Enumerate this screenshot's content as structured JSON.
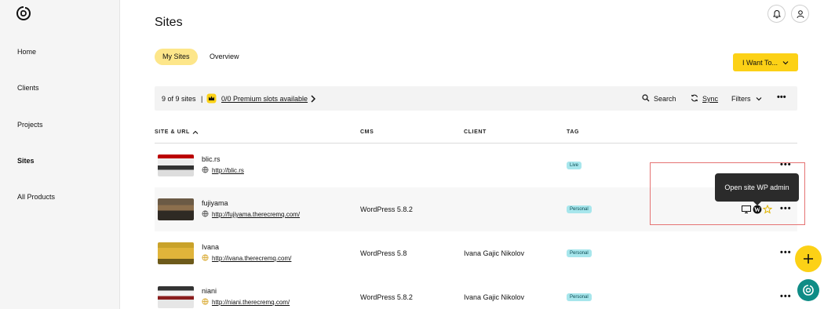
{
  "sidebar": {
    "items": [
      {
        "label": "Home"
      },
      {
        "label": "Clients"
      },
      {
        "label": "Projects"
      },
      {
        "label": "Sites"
      },
      {
        "label": "All Products"
      }
    ]
  },
  "header": {
    "title": "Sites"
  },
  "tabs": [
    {
      "label": "My Sites"
    },
    {
      "label": "Overview"
    }
  ],
  "actions": {
    "i_want_to_label": "I Want To..."
  },
  "toolbar": {
    "site_count": "9 of 9 sites",
    "separator": "|",
    "premium_slots": "0/0 Premium slots available",
    "search_label": "Search",
    "sync_label": "Sync",
    "filters_label": "Filters"
  },
  "table": {
    "columns": [
      "SITE & URL",
      "CMS",
      "CLIENT",
      "TAG"
    ],
    "rows": [
      {
        "name": "blic.rs",
        "url": "http://blic.rs",
        "cms": "",
        "client": "",
        "tag": "Live"
      },
      {
        "name": "fujiyama",
        "url": "http://fujiyama.therecremq.com/",
        "cms": "WordPress 5.8.2",
        "client": "",
        "tag": "Personal"
      },
      {
        "name": "Ivana",
        "url": "http://ivana.therecremq.com/",
        "cms": "WordPress 5.8",
        "client": "Ivana Gajic Nikolov",
        "tag": "Personal"
      },
      {
        "name": "niani",
        "url": "http://niani.therecremq.com/",
        "cms": "WordPress 5.8.2",
        "client": "Ivana Gajic Nikolov",
        "tag": "Personal"
      }
    ]
  },
  "tooltip": {
    "text": "Open site WP admin"
  },
  "colors": {
    "accent": "#fcd116",
    "tag_bg": "#a7e6ec",
    "chat_bg": "#0f8c86"
  },
  "icons": {
    "logo": "godaddy-logo-icon",
    "bell": "bell-icon",
    "user": "user-icon",
    "search": "search-icon",
    "sync": "sync-icon",
    "filters": "chevron-down-icon",
    "more": "more-icon",
    "globe": "globe-icon",
    "wp": "wordpress-icon",
    "star": "star-icon",
    "plus": "plus-icon",
    "chat": "chat-icon"
  }
}
